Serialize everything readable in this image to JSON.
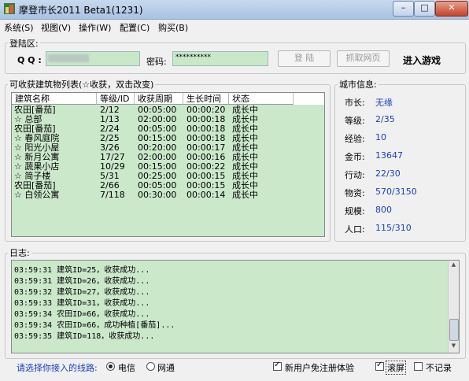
{
  "window": {
    "title": "摩登市长2011 Beta1(1231)",
    "min_label": "–",
    "max_label": "□",
    "close_label": "✕"
  },
  "menu": [
    "系统(S)",
    "视图(V)",
    "操作(W)",
    "配置(C)",
    "购买(B)"
  ],
  "login": {
    "group_label": "登陆区:",
    "qq_label": "Q Q :",
    "qq_value": "",
    "password_label": "密码:",
    "password_value": "**********",
    "login_button": "登 陆",
    "fetch_button": "抓取网页",
    "enter_game": "进入游戏"
  },
  "buildings": {
    "group_label": "可收获建筑物列表(☆收获，双击改变)",
    "columns": [
      "建筑名称",
      "等级/ID",
      "收获周期",
      "生长时间",
      "状态"
    ],
    "rows": [
      [
        "农田[番茄]",
        "2/12",
        "00:05:00",
        "00:00:20",
        "成长中"
      ],
      [
        "☆ 总部",
        "1/13",
        "02:00:00",
        "00:00:18",
        "成长中"
      ],
      [
        "农田[番茄]",
        "2/24",
        "00:05:00",
        "00:00:18",
        "成长中"
      ],
      [
        "☆ 春风庭院",
        "2/25",
        "00:15:00",
        "00:00:18",
        "成长中"
      ],
      [
        "☆ 阳光小屋",
        "3/26",
        "00:20:00",
        "00:00:17",
        "成长中"
      ],
      [
        "☆ 新月公寓",
        "17/27",
        "02:00:00",
        "00:00:16",
        "成长中"
      ],
      [
        "☆ 蔬果小店",
        "10/29",
        "00:15:00",
        "00:00:22",
        "成长中"
      ],
      [
        "☆ 简子楼",
        "5/31",
        "00:25:00",
        "00:00:15",
        "成长中"
      ],
      [
        "农田[番茄]",
        "2/66",
        "00:05:00",
        "00:00:15",
        "成长中"
      ],
      [
        "☆ 白领公寓",
        "7/118",
        "00:30:00",
        "00:00:14",
        "成长中"
      ]
    ]
  },
  "city": {
    "group_label": "城市信息:",
    "items": [
      {
        "label": "市长:",
        "value": "无缘"
      },
      {
        "label": "等级:",
        "value": "2/35"
      },
      {
        "label": "经验:",
        "value": "10"
      },
      {
        "label": "金币:",
        "value": "13647"
      },
      {
        "label": "行动:",
        "value": "22/30"
      },
      {
        "label": "物资:",
        "value": "570/3150"
      },
      {
        "label": "规模:",
        "value": "800"
      },
      {
        "label": "人口:",
        "value": "115/310"
      }
    ]
  },
  "log": {
    "group_label": "日志:",
    "lines": [
      "03:59:31 建筑ID=25，收获成功...",
      "03:59:31 建筑ID=26，收获成功...",
      "03:59:32 建筑ID=27，收获成功...",
      "03:59:33 建筑ID=31，收获成功...",
      "03:59:34 农田ID=66，收获成功...",
      "03:59:34 农田ID=66，成功种植[番茄]...",
      "03:59:35 建筑ID=118，收获成功..."
    ]
  },
  "footer": {
    "line_prompt": "请选择你接入的线路:",
    "radio_telecom": "电信",
    "radio_netcom": "网通",
    "new_user_check": "新用户免注册体验",
    "scroll_check": "滚屏",
    "no_log_check": "不记录"
  },
  "colors": {
    "list_bg": "#cbe8cb",
    "link_blue": "#1a3fbf",
    "prompt_blue": "#1a3fbf"
  }
}
